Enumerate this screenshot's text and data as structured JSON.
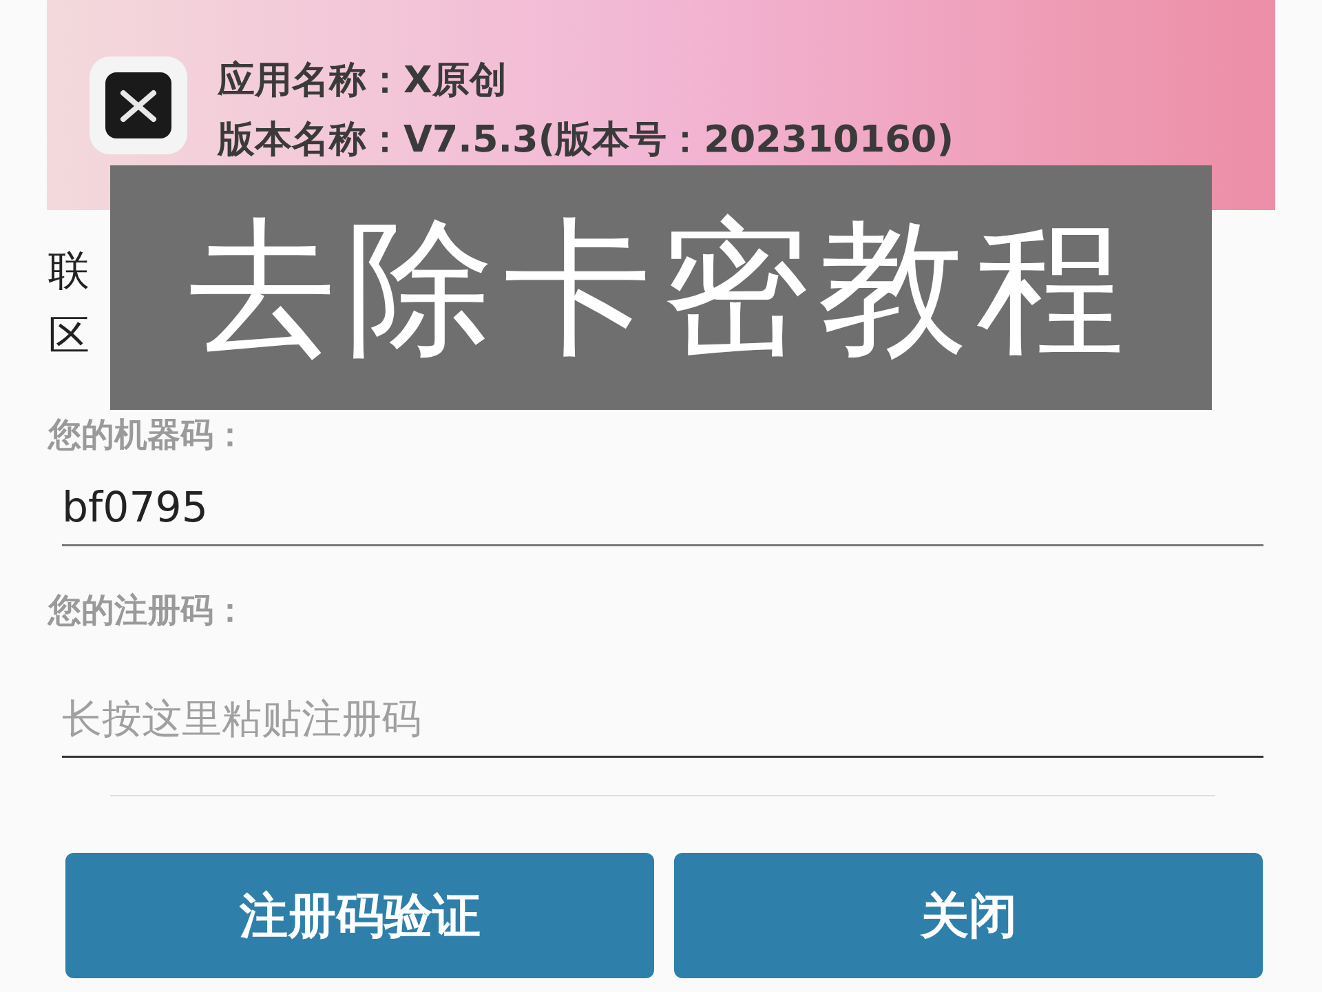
{
  "app_info": {
    "name_label": "应用名称：X原创",
    "version_label": "版本名称：V7.5.3(版本号：202310160)"
  },
  "overlay_title": "去除卡密教程",
  "notice_fragments": {
    "line_1_start": "联",
    "line_2_start": "区"
  },
  "machine_code": {
    "label": "您的机器码：",
    "value": "bf0795"
  },
  "register_code": {
    "label": "您的注册码：",
    "placeholder": "长按这里粘贴注册码"
  },
  "buttons": [
    {
      "label": "注册码验证"
    },
    {
      "label": "关闭"
    }
  ]
}
